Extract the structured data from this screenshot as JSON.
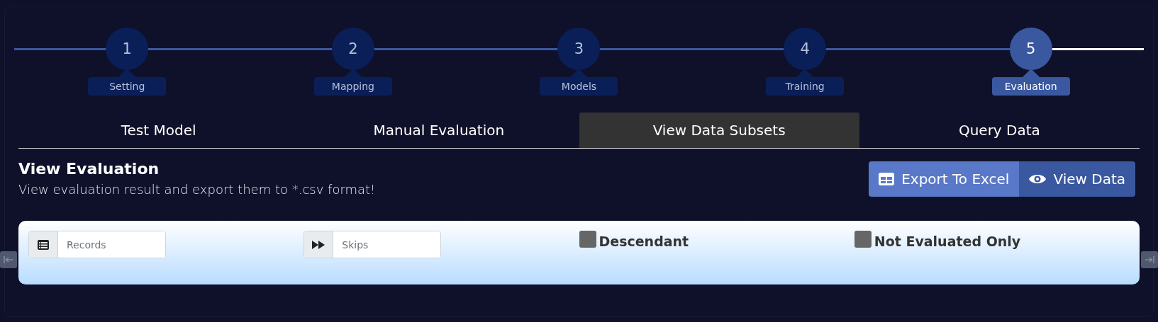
{
  "stepper": [
    {
      "number": "1",
      "label": "Setting",
      "selected": false
    },
    {
      "number": "2",
      "label": "Mapping",
      "selected": false
    },
    {
      "number": "3",
      "label": "Models",
      "selected": false
    },
    {
      "number": "4",
      "label": "Training",
      "selected": false
    },
    {
      "number": "5",
      "label": "Evaluation",
      "selected": true
    }
  ],
  "tabs": [
    {
      "label": "Test Model",
      "selected": false
    },
    {
      "label": "Manual Evaluation",
      "selected": false
    },
    {
      "label": "View Data Subsets",
      "selected": true
    },
    {
      "label": "Query Data",
      "selected": false
    }
  ],
  "header": {
    "title": "View Evaluation",
    "subtitle": "View evaluation result and export them to *.csv format!"
  },
  "buttons": [
    {
      "kind": "export",
      "label": "Export To Excel"
    },
    {
      "kind": "view",
      "label": "View Data"
    }
  ],
  "filters": [
    {
      "kind": "input",
      "placeholder": "Records"
    },
    {
      "kind": "input",
      "placeholder": "Skips"
    },
    {
      "kind": "checkbox",
      "label": "Descendant",
      "checked": false
    },
    {
      "kind": "checkbox",
      "label": "Not Evaluated Only",
      "checked": false
    }
  ]
}
